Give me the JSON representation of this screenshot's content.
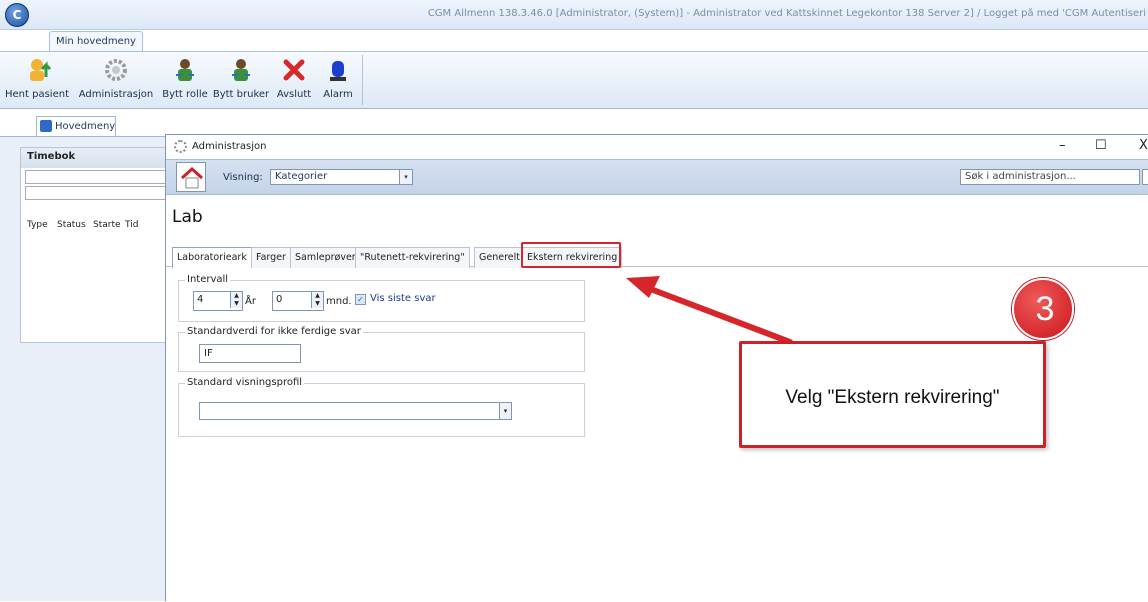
{
  "window": {
    "title": "CGM Allmenn 138.3.46.0 [Administrator, (System)] - Administrator ved Kattskinnet Legekontor 138 Server 2] / Logget på med 'CGM Autentiseri"
  },
  "ribbon": {
    "tab_label": "Min hovedmeny",
    "buttons": [
      {
        "label": "Hent pasient",
        "icon": "patient-arrow-icon"
      },
      {
        "label": "Administrasjon",
        "icon": "gear-icon"
      },
      {
        "label": "Bytt rolle",
        "icon": "switch-role-icon"
      },
      {
        "label": "Bytt bruker",
        "icon": "switch-user-icon"
      },
      {
        "label": "Avslutt",
        "icon": "exit-x-icon"
      },
      {
        "label": "Alarm",
        "icon": "alarm-light-icon"
      }
    ]
  },
  "doc_tab": {
    "label": "Hovedmeny"
  },
  "timebok": {
    "title": "Timebok",
    "columns": [
      "Type",
      "Status",
      "Starte",
      "Tid"
    ]
  },
  "admin": {
    "title": "Administrasjon",
    "visning_label": "Visning:",
    "visning_value": "Kategorier",
    "search_placeholder": "Søk i administrasjon...",
    "heading": "Lab",
    "tabs": [
      {
        "label": "Laboratorieark",
        "active": true
      },
      {
        "label": "Farger",
        "active": false
      },
      {
        "label": "Samleprøver",
        "active": false
      },
      {
        "label": "\"Rutenett-rekvirering\"",
        "active": false
      },
      {
        "label": "Generelt",
        "active": false
      },
      {
        "label": "Ekstern rekvirering",
        "active": false
      }
    ],
    "intervall": {
      "title": "Intervall",
      "years_value": "4",
      "years_label": "År",
      "months_value": "0",
      "months_label": "mnd.",
      "checkbox_label": "Vis siste svar",
      "checkbox_checked": true
    },
    "standardverdi": {
      "title": "Standardverdi for ikke ferdige svar",
      "value": "IF"
    },
    "visningsprofil": {
      "title": "Standard visningsprofil",
      "value": ""
    }
  },
  "annotation": {
    "step_number": "3",
    "callout_text": "Velg \"Ekstern rekvirering\"",
    "accent_color": "#d6252b"
  }
}
